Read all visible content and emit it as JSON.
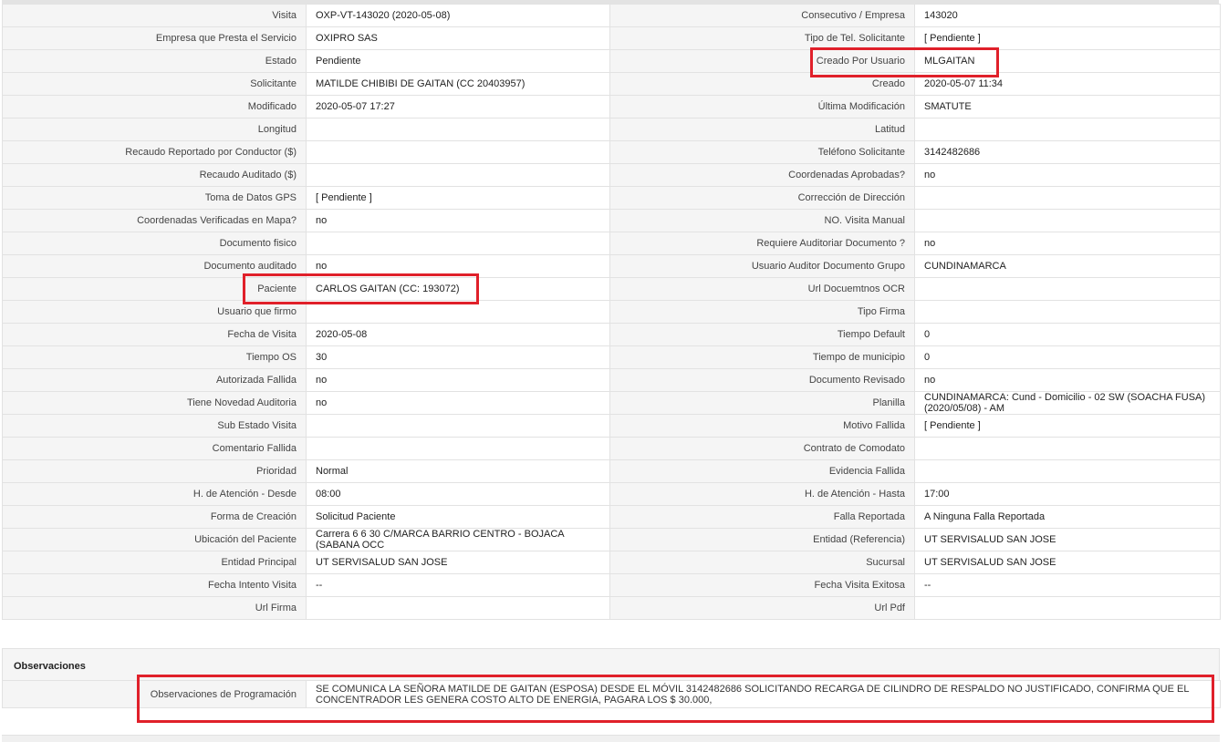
{
  "details": {
    "rows": [
      {
        "l1": "Visita",
        "v1": "OXP-VT-143020 (2020-05-08)",
        "l2": "Consecutivo / Empresa",
        "v2": "143020"
      },
      {
        "l1": "Empresa que Presta el Servicio",
        "v1": "OXIPRO SAS",
        "l2": "Tipo de Tel. Solicitante",
        "v2": "[ Pendiente ]"
      },
      {
        "l1": "Estado",
        "v1": "Pendiente",
        "l2": "Creado Por Usuario",
        "v2": "MLGAITAN"
      },
      {
        "l1": "Solicitante",
        "v1": "MATILDE CHIBIBI DE GAITAN (CC 20403957)",
        "l2": "Creado",
        "v2": "2020-05-07 11:34"
      },
      {
        "l1": "Modificado",
        "v1": "2020-05-07 17:27",
        "l2": "Última Modificación",
        "v2": " SMATUTE"
      },
      {
        "l1": "Longitud",
        "v1": "",
        "l2": "Latitud",
        "v2": ""
      },
      {
        "l1": "Recaudo Reportado por Conductor ($)",
        "v1": "",
        "l2": "Teléfono Solicitante",
        "v2": "3142482686"
      },
      {
        "l1": "Recaudo Auditado ($)",
        "v1": "",
        "l2": "Coordenadas Aprobadas?",
        "v2": " no"
      },
      {
        "l1": "Toma de Datos GPS",
        "v1": "[ Pendiente ]",
        "l2": "Corrección de Dirección",
        "v2": ""
      },
      {
        "l1": "Coordenadas Verificadas en Mapa?",
        "v1": " no",
        "l2": "NO. Visita Manual",
        "v2": ""
      },
      {
        "l1": "Documento fisico",
        "v1": "",
        "l2": "Requiere Auditoriar Documento ?",
        "v2": " no"
      },
      {
        "l1": "Documento auditado",
        "v1": " no",
        "l2": "Usuario Auditor Documento Grupo",
        "v2": "CUNDINAMARCA"
      },
      {
        "l1": "Paciente",
        "v1": "CARLOS GAITAN (CC: 193072)",
        "l2": "Url Docuemtnos OCR",
        "v2": ""
      },
      {
        "l1": "Usuario que firmo",
        "v1": "",
        "l2": "Tipo Firma",
        "v2": ""
      },
      {
        "l1": "Fecha de Visita",
        "v1": " 2020-05-08",
        "l2": "Tiempo Default",
        "v2": "0"
      },
      {
        "l1": "Tiempo OS",
        "v1": "30",
        "l2": "Tiempo de municipio",
        "v2": "0"
      },
      {
        "l1": "Autorizada Fallida",
        "v1": " no",
        "l2": "Documento Revisado",
        "v2": " no"
      },
      {
        "l1": "Tiene Novedad Auditoria",
        "v1": " no",
        "l2": "Planilla",
        "v2": "CUNDINAMARCA: Cund - Domicilio - 02 SW (SOACHA FUSA) (2020/05/08) - AM"
      },
      {
        "l1": "Sub Estado Visita",
        "v1": "",
        "l2": "Motivo Fallida",
        "v2": "[ Pendiente ]"
      },
      {
        "l1": "Comentario Fallida",
        "v1": "",
        "l2": "Contrato de Comodato",
        "v2": ""
      },
      {
        "l1": "Prioridad",
        "v1": "Normal",
        "l2": "Evidencia Fallida",
        "v2": ""
      },
      {
        "l1": "H. de Atención - Desde",
        "v1": "08:00",
        "l2": "H. de Atención - Hasta",
        "v2": " 17:00"
      },
      {
        "l1": "Forma de Creación",
        "v1": "Solicitud Paciente",
        "l2": "Falla Reportada",
        "v2": "A Ninguna Falla Reportada"
      },
      {
        "l1": "Ubicación del Paciente",
        "v1": "Carrera 6 6 30 C/MARCA BARRIO CENTRO - BOJACA (SABANA OCC",
        "l2": "Entidad (Referencia)",
        "v2": "UT SERVISALUD SAN JOSE"
      },
      {
        "l1": "Entidad Principal",
        "v1": "UT SERVISALUD SAN JOSE",
        "l2": "Sucursal",
        "v2": "UT SERVISALUD SAN JOSE"
      },
      {
        "l1": "Fecha Intento Visita",
        "v1": " --",
        "l2": "Fecha Visita Exitosa",
        "v2": " --"
      },
      {
        "l1": "Url Firma",
        "v1": "",
        "l2": "Url Pdf",
        "v2": ""
      }
    ]
  },
  "observaciones": {
    "title": "Observaciones",
    "label": "Observaciones de Programación",
    "value": "   SE COMUNICA LA SEÑORA MATILDE DE GAITAN (ESPOSA) DESDE EL MÓVIL 3142482686 SOLICITANDO RECARGA DE CILINDRO DE RESPALDO NO JUSTIFICADO, CONFIRMA QUE EL CONCENTRADOR LES GENERA COSTO ALTO DE ENERGIA, PAGARA LOS $ 30.000,"
  },
  "colors": {
    "highlight": "#e0202a",
    "label_bg": "#f5f5f5",
    "border": "#e2e2e2"
  }
}
